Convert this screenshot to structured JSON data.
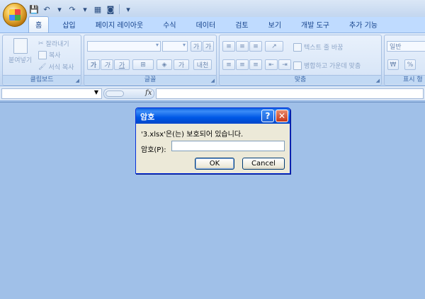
{
  "qat": {
    "dropdown_glyph": "▾"
  },
  "tabs": [
    "홈",
    "삽입",
    "페이지 레이아웃",
    "수식",
    "데이터",
    "검토",
    "보기",
    "개발 도구",
    "추가 기능"
  ],
  "clipboard": {
    "paste": "붙여넣기",
    "cut": "잘라내기",
    "copy": "복사",
    "format_painter": "서식 복사",
    "label": "클립보드"
  },
  "font": {
    "grow": "가",
    "shrink": "가",
    "bold": "가",
    "italic": "가",
    "underline": "가",
    "font_color": "가",
    "phonetic": "내천",
    "label": "글꼴"
  },
  "alignment": {
    "wrap_text": "텍스트 줄 바꿈",
    "merge_center": "병합하고 가운데 맞춤",
    "label": "맞춤"
  },
  "number": {
    "format": "일반",
    "currency": "₩",
    "percent": "%",
    "label": "표시 형"
  },
  "formula_bar": {
    "fx": "fx"
  },
  "dialog": {
    "title": "암호",
    "message": "'3.xlsx'은(는) 보호되어 있습니다.",
    "password_label": "암호(P):",
    "ok": "OK",
    "cancel": "Cancel",
    "help": "?",
    "close": "✕"
  },
  "colors": {
    "title_blue": "#0058e6",
    "workspace": "#a0c0e8",
    "dialog_bg": "#ece9d8"
  }
}
